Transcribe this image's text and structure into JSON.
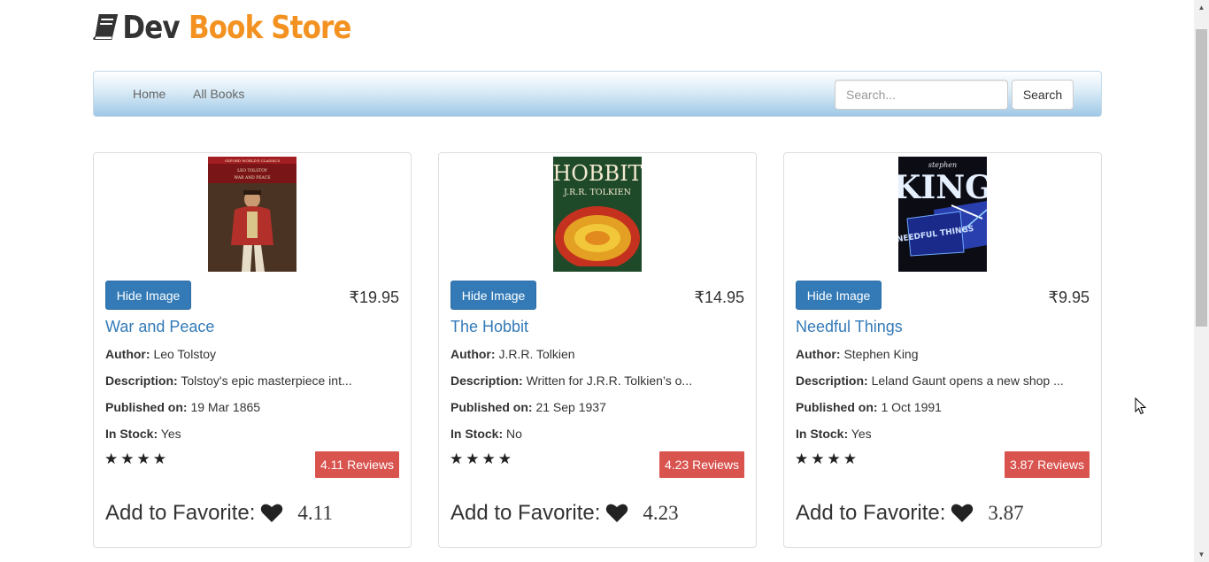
{
  "brand": {
    "part1": "Dev",
    "part2": "Book Store",
    "icon": "book-icon",
    "accent": "#f39221"
  },
  "nav": {
    "links": [
      "Home",
      "All Books"
    ],
    "search_placeholder": "Search...",
    "search_value": "",
    "search_button": "Search"
  },
  "labels": {
    "hide_image": "Hide Image",
    "author": "Author:",
    "description": "Description:",
    "published": "Published on:",
    "in_stock": "In Stock:",
    "add_to_favorite": "Add to Favorite:"
  },
  "books": [
    {
      "title": "War and Peace",
      "price": "₹19.95",
      "author": "Leo Tolstoy",
      "description": "Tolstoy's epic masterpiece int...",
      "published": "19 Mar 1865",
      "in_stock": "Yes",
      "stars": "★★★★",
      "reviews": "4.11 Reviews",
      "rating": "4.11",
      "cover_text": {
        "series": "OXFORD WORLD'S CLASSICS",
        "author": "LEO TOLSTOY",
        "title": "WAR AND PEACE"
      }
    },
    {
      "title": "The Hobbit",
      "price": "₹14.95",
      "author": "J.R.R. Tolkien",
      "description": "Written for J.R.R. Tolkien’s o...",
      "published": "21 Sep 1937",
      "in_stock": "No",
      "stars": "★★★★",
      "reviews": "4.23 Reviews",
      "rating": "4.23",
      "cover_text": {
        "title": "HOBBIT",
        "author": "J.R.R. TOLKIEN"
      }
    },
    {
      "title": "Needful Things",
      "price": "₹9.95",
      "author": "Stephen King",
      "description": "Leland Gaunt opens a new shop ...",
      "published": "1 Oct 1991",
      "in_stock": "Yes",
      "stars": "★★★★",
      "reviews": "3.87 Reviews",
      "rating": "3.87",
      "cover_text": {
        "author_first": "stephen",
        "author_last": "KING",
        "title": "NEEDFUL THINGS"
      }
    }
  ],
  "colors": {
    "primary": "#337ab7",
    "danger": "#d9534f",
    "link": "#337ab7"
  }
}
